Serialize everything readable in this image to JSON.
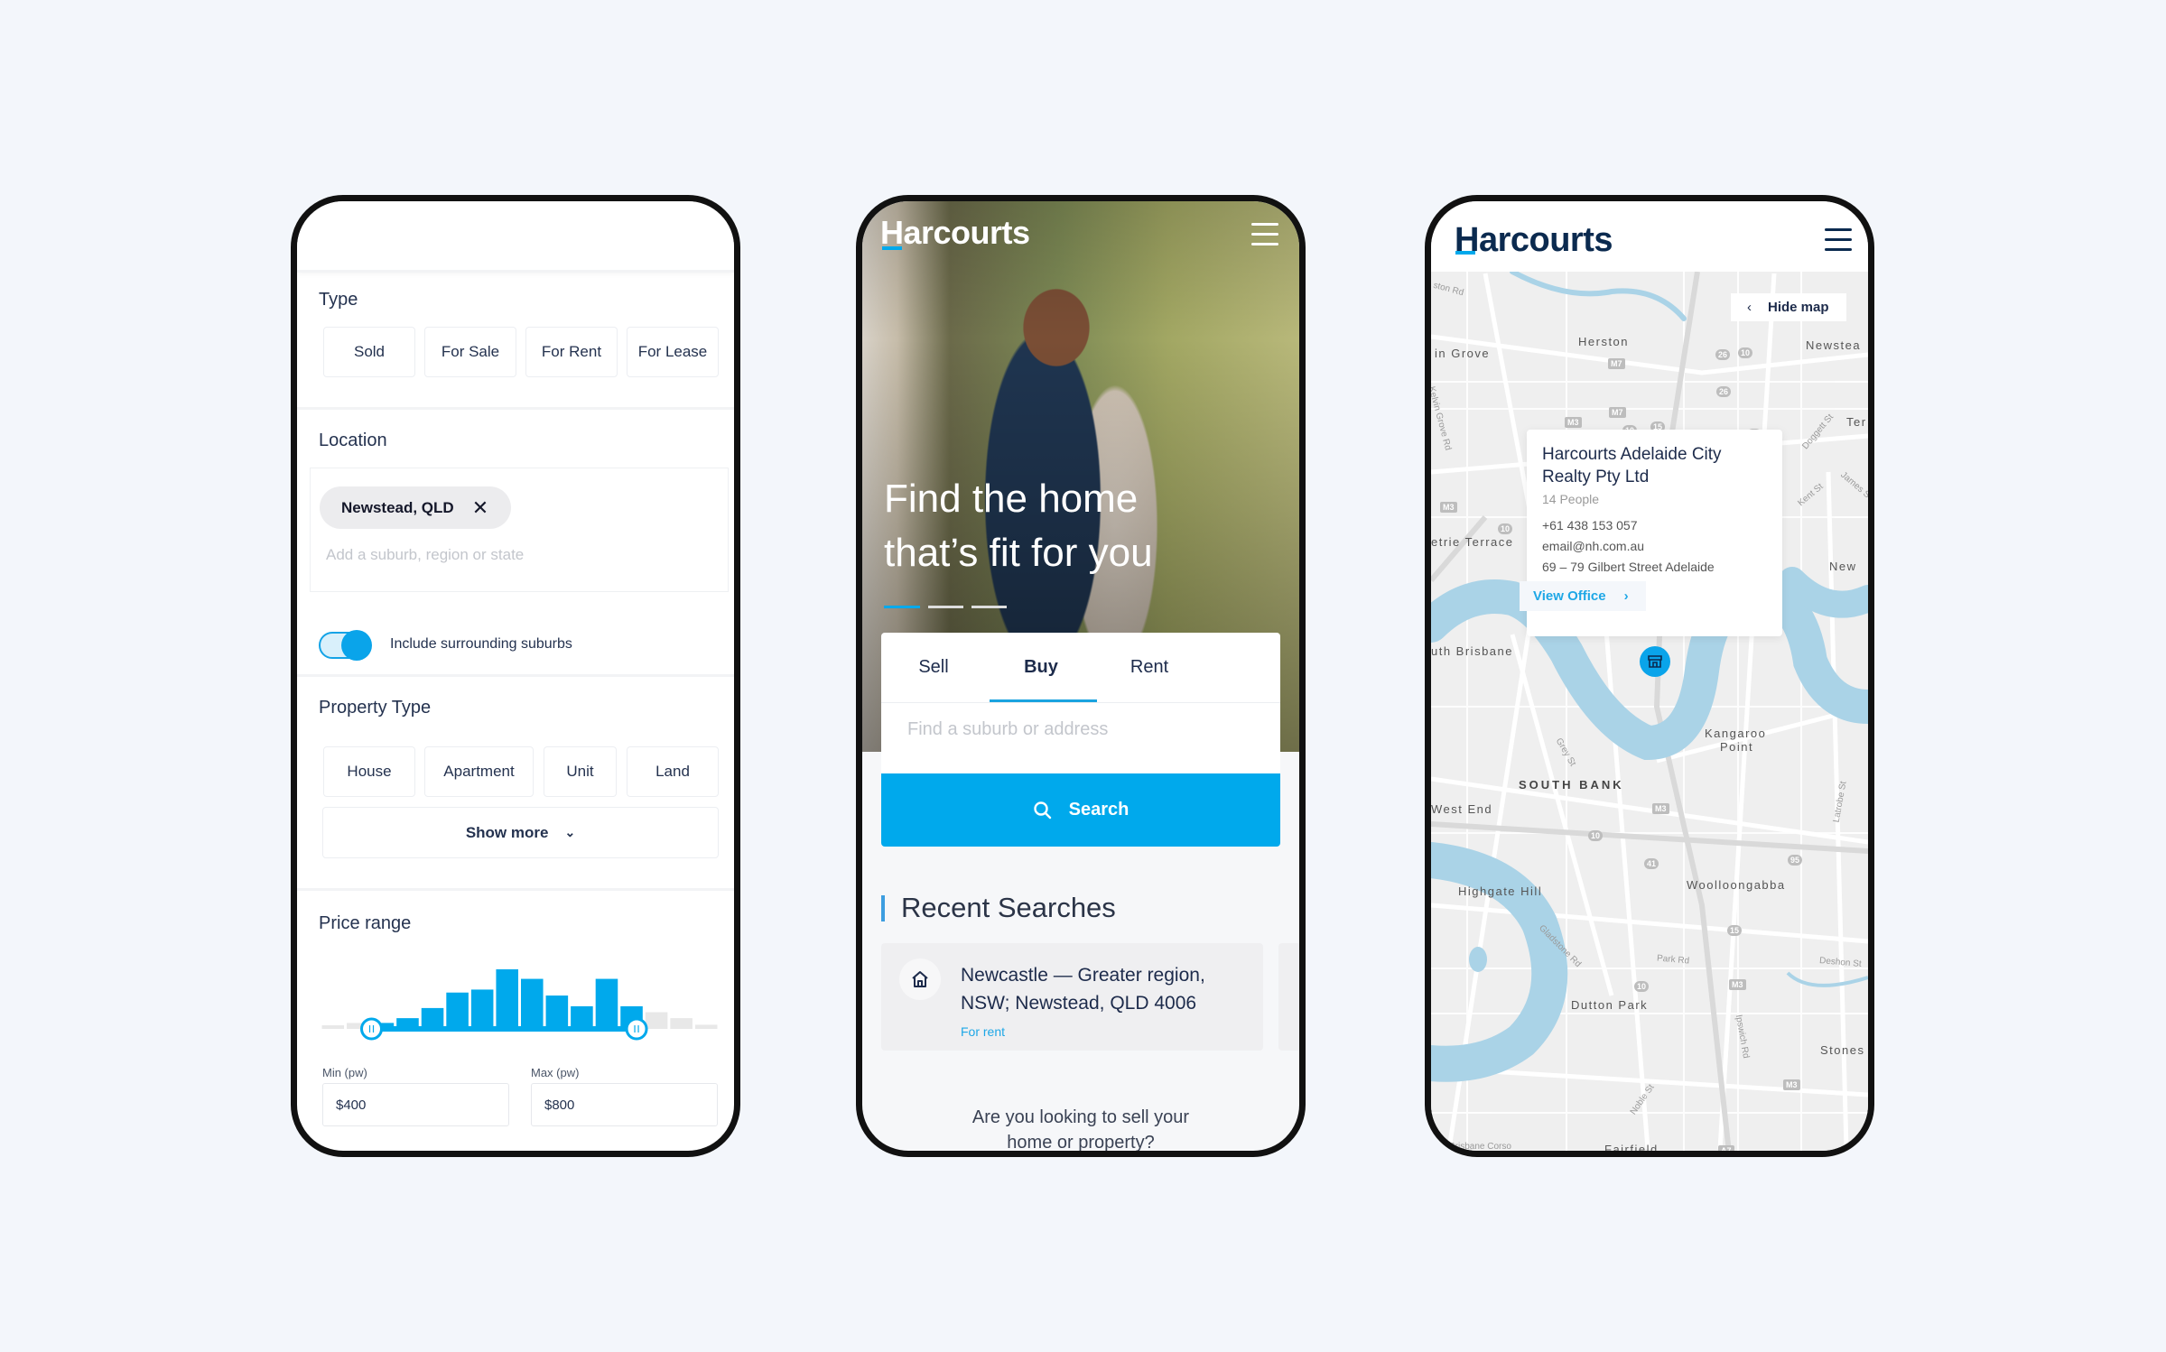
{
  "colors": {
    "accent": "#00a9ec",
    "navy": "#0b2a4f",
    "background": "#f3f6fb"
  },
  "filters": {
    "type_label": "Type",
    "type_options": [
      "Sold",
      "For Sale",
      "For Rent",
      "For Lease"
    ],
    "location_label": "Location",
    "location_chip": "Newstead, QLD",
    "location_placeholder": "Add a suburb, region or state",
    "include_surrounding_label": "Include surrounding suburbs",
    "include_surrounding_on": true,
    "property_type_label": "Property Type",
    "property_types": [
      "House",
      "Apartment",
      "Unit",
      "Land"
    ],
    "show_more_label": "Show more",
    "price_range_label": "Price range",
    "min_label": "Min (pw)",
    "min_value": "$400",
    "max_label": "Max (pw)",
    "max_value": "$800"
  },
  "chart_data": {
    "type": "bar",
    "values": [
      6,
      10,
      10,
      18,
      35,
      61,
      66,
      100,
      84,
      56,
      38,
      84,
      38,
      28,
      18,
      7
    ],
    "selected_range_index": [
      2,
      12
    ],
    "colors": {
      "selected": "#00a9ec",
      "unselected": "#e8e8e8"
    }
  },
  "home": {
    "logo": "Harcourts",
    "headline_line1": "Find the home",
    "headline_line2": "that’s fit for you",
    "carousel_active": 0,
    "tabs": [
      "Sell",
      "Buy",
      "Rent"
    ],
    "active_tab": "Buy",
    "search_placeholder": "Find a suburb or address",
    "search_button": "Search",
    "recent_title": "Recent Searches",
    "recent": [
      {
        "line1": "Newcastle — Greater region,",
        "line2": "NSW; Newstead, QLD 4006",
        "tag": "For rent"
      }
    ],
    "sell_prompt_line1": "Are you looking to sell your",
    "sell_prompt_line2": "home or property?"
  },
  "map_screen": {
    "logo": "Harcourts",
    "hide_map": "Hide map",
    "office": {
      "name_line1": "Harcourts Adelaide City",
      "name_line2": "Realty Pty Ltd",
      "people": "14 People",
      "phone": "+61 438 153 057",
      "email": "email@nh.com.au",
      "address": "69 – 79 Gilbert Street Adelaide",
      "view_office": "View Office"
    },
    "places": [
      "Herston",
      "in Grove",
      "Newstea",
      "Ter",
      "etrie Terrace",
      "New",
      "uth Brisbane",
      "Kangaroo",
      "Point",
      "SOUTH BANK",
      "West End",
      "Highgate Hill",
      "Woolloongabba",
      "Dutton Park",
      "Stones",
      "Fairfield"
    ],
    "streets": [
      "Kelvin Grove Rd",
      "Grey St",
      "Gladstone Rd",
      "Park Rd",
      "Ipswich Rd",
      "Latrobe St",
      "Deshon St",
      "Noble St",
      "Doggett St",
      "Kent St",
      "James St",
      "Brisbane Corso",
      "ston Rd"
    ],
    "shields": [
      "M7",
      "M7",
      "26",
      "10",
      "26",
      "15",
      "M3",
      "10",
      "25",
      "M3",
      "10",
      "M3",
      "10",
      "41",
      "95",
      "15",
      "M3",
      "10",
      "M3",
      "A7"
    ]
  }
}
